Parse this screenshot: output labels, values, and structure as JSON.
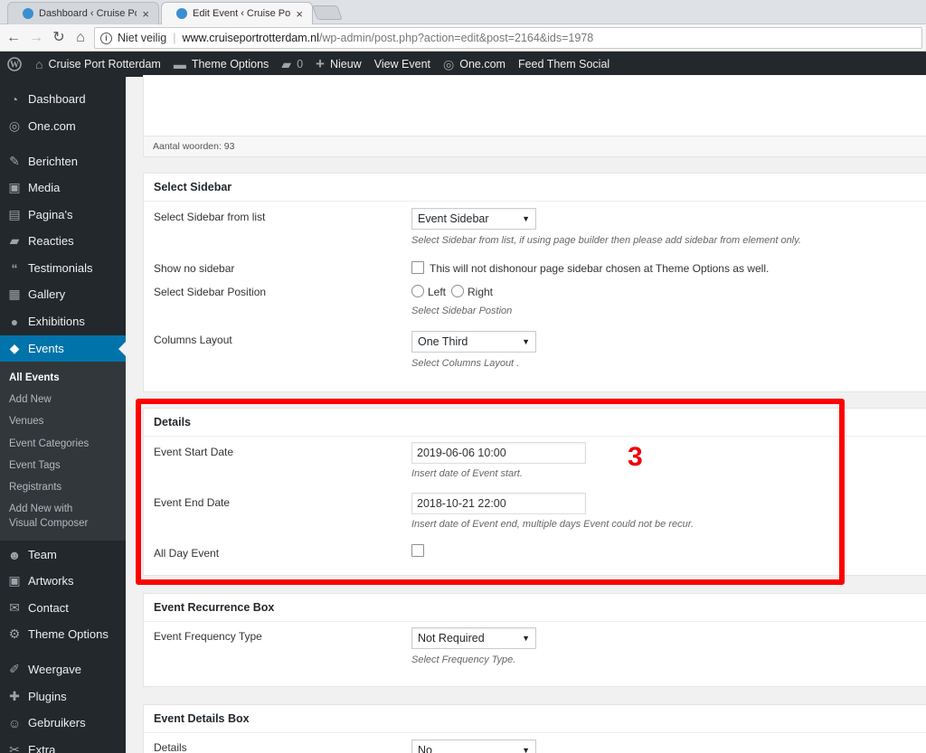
{
  "browser": {
    "tabs": [
      {
        "title": "Dashboard ‹ Cruise Port R",
        "close": "×"
      },
      {
        "title": "Edit Event ‹ Cruise Port R",
        "close": "×"
      }
    ],
    "security": "Niet veilig",
    "url_domain": "www.cruiseportrotterdam.nl",
    "url_path": "/wp-admin/post.php?action=edit&post=2164&ids=1978"
  },
  "adminbar": {
    "site": "Cruise Port Rotterdam",
    "theme_options": "Theme Options",
    "comments": "0",
    "new": "Nieuw",
    "view": "View Event",
    "onecom": "One.com",
    "feed": "Feed Them Social"
  },
  "sidebar": {
    "items": [
      {
        "label": "Dashboard",
        "icon": "dashboard-icon"
      },
      {
        "label": "One.com",
        "icon": "onecom-icon"
      },
      {
        "label": "Berichten",
        "icon": "pin-icon"
      },
      {
        "label": "Media",
        "icon": "media-icon"
      },
      {
        "label": "Pagina's",
        "icon": "page-icon"
      },
      {
        "label": "Reacties",
        "icon": "comment-icon"
      },
      {
        "label": "Testimonials",
        "icon": "quote-icon"
      },
      {
        "label": "Gallery",
        "icon": "gallery-icon"
      },
      {
        "label": "Exhibitions",
        "icon": "exhibition-icon"
      },
      {
        "label": "Events",
        "icon": "events-icon"
      }
    ],
    "submenu": [
      "All Events",
      "Add New",
      "Venues",
      "Event Categories",
      "Event Tags",
      "Registrants",
      "Add New with",
      "Visual Composer"
    ],
    "items2": [
      {
        "label": "Team",
        "icon": "team-icon"
      },
      {
        "label": "Artworks",
        "icon": "artworks-icon"
      },
      {
        "label": "Contact",
        "icon": "contact-icon"
      },
      {
        "label": "Theme Options",
        "icon": "gear-icon"
      },
      {
        "label": "Weergave",
        "icon": "brush-icon"
      },
      {
        "label": "Plugins",
        "icon": "plugin-icon"
      },
      {
        "label": "Gebruikers",
        "icon": "users-icon"
      },
      {
        "label": "Extra",
        "icon": "tools-icon"
      }
    ]
  },
  "editor": {
    "word_count": "Aantal woorden: 93"
  },
  "select_sidebar": {
    "title": "Select Sidebar",
    "from_list_label": "Select Sidebar from list",
    "from_list_value": "Event Sidebar",
    "from_list_desc": "Select Sidebar from list, if using page builder then please add sidebar from element only.",
    "no_sidebar_label": "Show no sidebar",
    "no_sidebar_desc": "This will not dishonour page sidebar chosen at Theme Options as well.",
    "position_label": "Select Sidebar Position",
    "left": "Left",
    "right": "Right",
    "position_desc": "Select Sidebar Postion",
    "columns_label": "Columns Layout",
    "columns_value": "One Third",
    "columns_desc": "Select Columns Layout ."
  },
  "details": {
    "title": "Details",
    "start_label": "Event Start Date",
    "start_value": "2019-06-06 10:00",
    "start_desc": "Insert date of Event start.",
    "end_label": "Event End Date",
    "end_value": "2018-10-21 22:00",
    "end_desc": "Insert date of Event end, multiple days Event could not be recur.",
    "allday_label": "All Day Event"
  },
  "annotation": "3",
  "recurrence": {
    "title": "Event Recurrence Box",
    "freq_label": "Event Frequency Type",
    "freq_value": "Not Required",
    "freq_desc": "Select Frequency Type."
  },
  "event_details": {
    "title": "Event Details Box",
    "details_label": "Details",
    "details_value": "No"
  },
  "colors": {
    "accent": "#0073aa",
    "annotation": "#ff0000",
    "sidebar": "#23282d"
  }
}
